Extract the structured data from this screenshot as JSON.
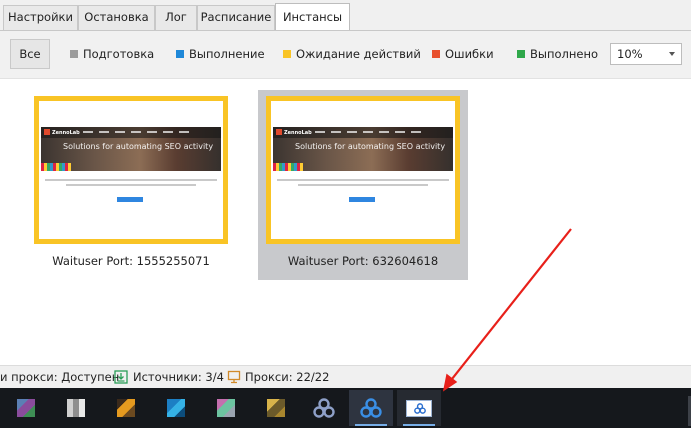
{
  "tabs": [
    {
      "label": "Настройки",
      "active": false
    },
    {
      "label": "Остановка",
      "active": false
    },
    {
      "label": "Лог",
      "active": false
    },
    {
      "label": "Расписание",
      "active": false
    },
    {
      "label": "Инстансы",
      "active": true
    }
  ],
  "filters": {
    "all_label": "Все",
    "items": [
      {
        "label": "Подготовка",
        "color": "#9b9b9b"
      },
      {
        "label": "Выполнение",
        "color": "#1f88d8"
      },
      {
        "label": "Ожидание действий",
        "color": "#f9c425"
      },
      {
        "label": "Ошибки",
        "color": "#e8502e"
      },
      {
        "label": "Выполнено",
        "color": "#2fa84a"
      }
    ],
    "zoom_value": "10%"
  },
  "instances": [
    {
      "caption": "Waituser Port: 1555255071",
      "selected": false,
      "site": {
        "logo": "ZennoLab",
        "headline": "Solutions for automating SEO activity"
      }
    },
    {
      "caption": "Waituser Port: 632604618",
      "selected": true,
      "site": {
        "logo": "ZennoLab",
        "headline": "Solutions for automating SEO activity"
      }
    }
  ],
  "status": {
    "proxy_check": "и прокси: Доступен",
    "sources": "Источники: 3/4",
    "proxies": "Прокси: 22/22"
  },
  "colors": {
    "highlight_border": "#f9c425",
    "selected_bg": "#c8c9cc",
    "arrow": "#e8201a",
    "taskbar": "#15181c"
  },
  "taskbar": {
    "items": [
      {
        "icon": "app-icon-1"
      },
      {
        "icon": "app-icon-2"
      },
      {
        "icon": "app-icon-3"
      },
      {
        "icon": "app-icon-4"
      },
      {
        "icon": "app-icon-5"
      },
      {
        "icon": "app-icon-6"
      },
      {
        "icon": "zennoposter-icon"
      },
      {
        "icon": "zennoposter-icon"
      },
      {
        "icon": "zennoposter-window-icon"
      }
    ]
  }
}
